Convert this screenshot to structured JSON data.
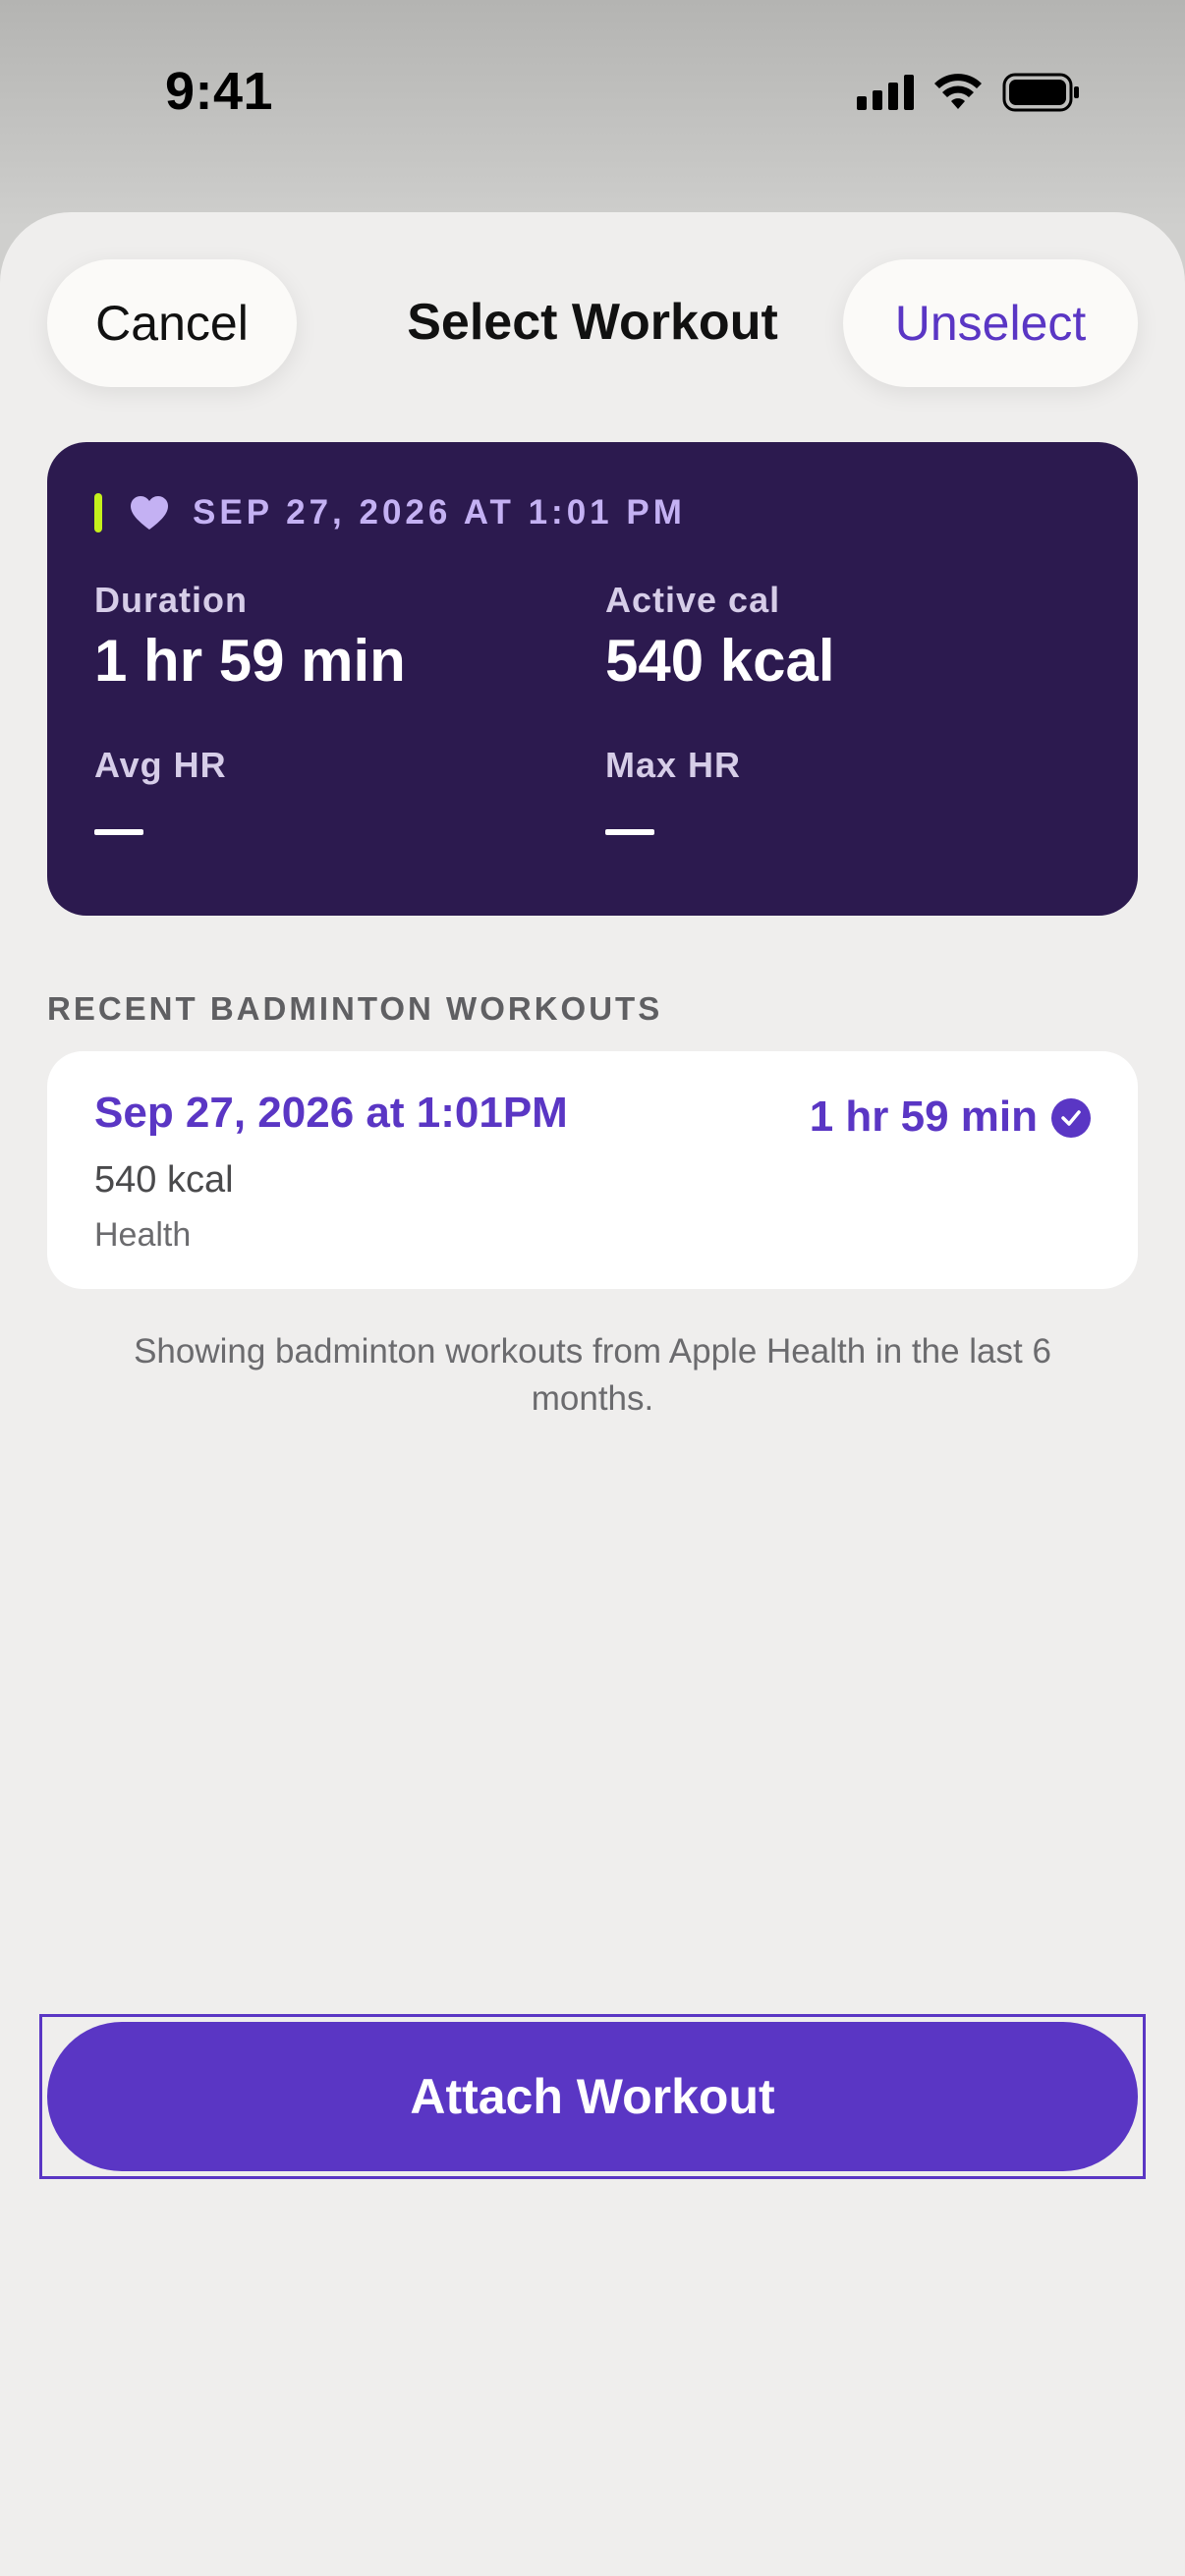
{
  "status_bar": {
    "time": "9:41"
  },
  "header": {
    "cancel_label": "Cancel",
    "title": "Select Workout",
    "unselect_label": "Unselect"
  },
  "summary": {
    "date": "SEP 27, 2026 AT 1:01 PM",
    "duration_label": "Duration",
    "duration_value": "1 hr 59 min",
    "active_cal_label": "Active cal",
    "active_cal_value": "540 kcal",
    "avg_hr_label": "Avg HR",
    "max_hr_label": "Max HR",
    "accent_color": "#c5f01c",
    "card_color": "#2c1a4f"
  },
  "recent": {
    "section_label": "RECENT BADMINTON WORKOUTS",
    "items": [
      {
        "date": "Sep 27, 2026 at 1:01PM",
        "duration": "1 hr 59 min",
        "kcal": "540 kcal",
        "source": "Health",
        "selected": true
      }
    ],
    "footnote": "Showing badminton workouts from Apple Health in the last 6 months."
  },
  "attach_label": "Attach Workout",
  "colors": {
    "accent": "#5a36c4",
    "sheet_bg": "#efeeed"
  },
  "icons": [
    "signal-icon",
    "wifi-icon",
    "battery-icon",
    "heart-icon",
    "checkmark-circle-icon"
  ]
}
